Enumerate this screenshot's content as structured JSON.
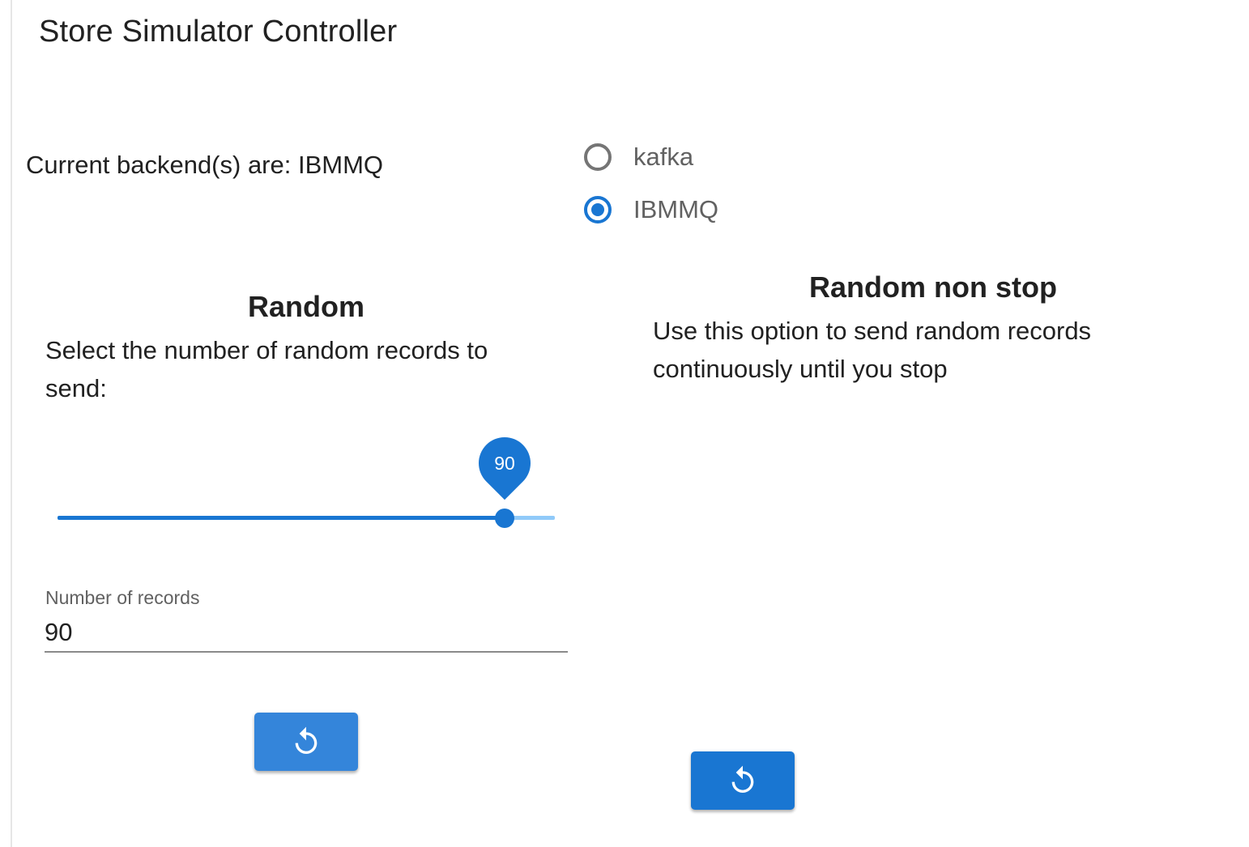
{
  "app": {
    "title": "Store Simulator Controller"
  },
  "backend": {
    "status_text": "Current backend(s) are: IBMMQ",
    "options": [
      {
        "label": "kafka",
        "selected": false
      },
      {
        "label": "IBMMQ",
        "selected": true
      }
    ]
  },
  "random": {
    "title": "Random",
    "description": "Select the number of random records to send:",
    "slider": {
      "value": "90",
      "level_fraction": 0.9
    },
    "records_field": {
      "label": "Number of records",
      "value": "90"
    },
    "button_icon": "refresh-icon"
  },
  "random_non_stop": {
    "title": "Random non stop",
    "description": "Use this option to send random records continuously until you stop",
    "button_icon": "refresh-icon"
  },
  "colors": {
    "primary": "#1976d2",
    "primary_light": "#90caf9",
    "button_random": "#3485da",
    "text": "#212121",
    "muted": "#616161"
  }
}
